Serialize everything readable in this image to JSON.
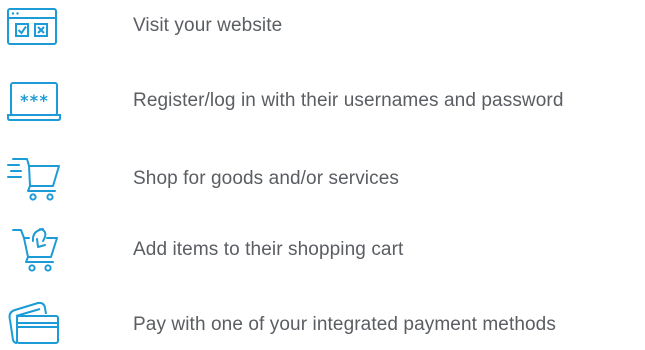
{
  "steps": [
    {
      "label": "Visit your website",
      "icon": "browser-checkbox-icon"
    },
    {
      "label": "Register/log in with their usernames and password",
      "icon": "laptop-password-icon"
    },
    {
      "label": "Shop for goods and/or services",
      "icon": "fast-shopping-cart-icon"
    },
    {
      "label": "Add items to their shopping cart",
      "icon": "add-to-cart-icon"
    },
    {
      "label": "Pay with one of your integrated payment methods",
      "icon": "credit-card-icon"
    }
  ],
  "colors": {
    "icon": "#1c9bd6",
    "text": "#5a5d62"
  }
}
